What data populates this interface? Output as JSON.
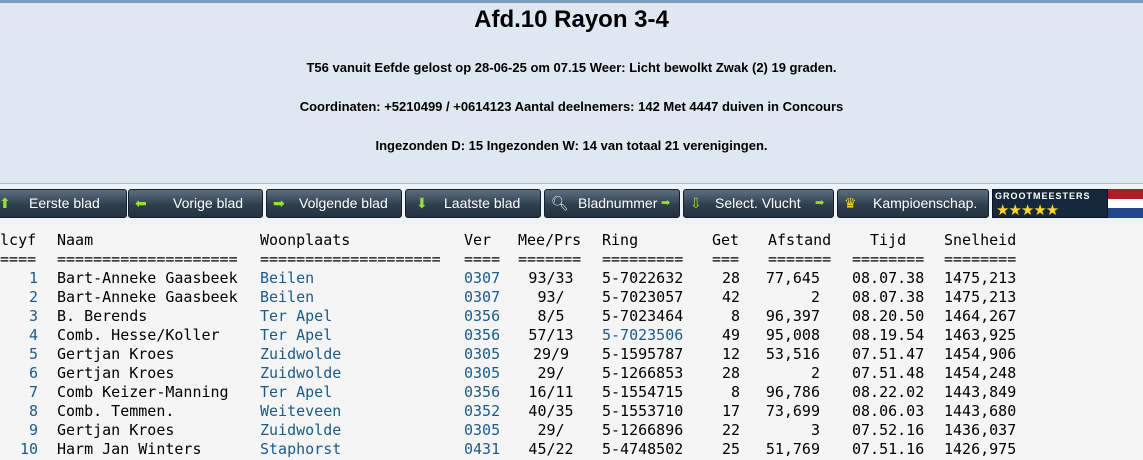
{
  "header": {
    "title": "Afd.10 Rayon 3-4",
    "line1": "T56 vanuit Eefde gelost op 28-06-25 om 07.15 Weer: Licht bewolkt Zwak (2) 19 graden.",
    "line2": "Coordinaten: +5210499 / +0614123 Aantal deelnemers: 142 Met 4447 duiven in Concours",
    "line3": "Ingezonden D: 15 Ingezonden W: 14 van totaal 21 verenigingen."
  },
  "nav": {
    "first": "Eerste blad",
    "prev": "Vorige blad",
    "next": "Volgende blad",
    "last": "Laatste blad",
    "page": "Bladnummer",
    "flight": "Select. Vlucht",
    "championship": "Kampioenschap.",
    "logo_text": "GROOTMEESTERS",
    "logo_stars": "★★★★★"
  },
  "colors": {
    "header_bg": "#dfe7f0",
    "button_bg": "#2f3f4e",
    "link": "#1a5b8a",
    "flag": [
      "#ae1c28",
      "#ffffff",
      "#21468b"
    ]
  },
  "table": {
    "headers": {
      "plcyf": "Plcyf",
      "naam": "Naam",
      "woonplaats": "Woonplaats",
      "ver": "Ver",
      "meeprs": "Mee/Prs",
      "ring": "Ring",
      "get": "Get",
      "afstand": "Afstand",
      "tijd": "Tijd",
      "snelheid": "Snelheid"
    },
    "underlines": {
      "plcyf": "=====",
      "naam": "====================",
      "woonplaats": "====================",
      "ver": "====",
      "meeprs": "=======",
      "ring": "=========",
      "get": "===",
      "afstand": "=======",
      "tijd": "========",
      "snelheid": "========"
    },
    "rows": [
      {
        "plcyf": "1",
        "naam": "Bart-Anneke Gaasbeek",
        "woonplaats": "Beilen",
        "ver": "0307",
        "meeprs": "93/33",
        "ring": "5-7022632",
        "get": "28",
        "afstand": "77,645",
        "tijd": "08.07.38",
        "snelheid": "1475,213"
      },
      {
        "plcyf": "2",
        "naam": "Bart-Anneke Gaasbeek",
        "woonplaats": "Beilen",
        "ver": "0307",
        "meeprs": "93/",
        "ring": "5-7023057",
        "get": "42",
        "afstand": "2",
        "tijd": "08.07.38",
        "snelheid": "1475,213"
      },
      {
        "plcyf": "3",
        "naam": "B. Berends",
        "woonplaats": "Ter Apel",
        "ver": "0356",
        "meeprs": "8/5",
        "ring": "5-7023464",
        "get": "8",
        "afstand": "96,397",
        "tijd": "08.20.50",
        "snelheid": "1464,267"
      },
      {
        "plcyf": "4",
        "naam": "Comb. Hesse/Koller",
        "woonplaats": "Ter Apel",
        "ver": "0356",
        "meeprs": "57/13",
        "ring": "5-7023506",
        "get": "49",
        "afstand": "95,008",
        "tijd": "08.19.54",
        "snelheid": "1463,925"
      },
      {
        "plcyf": "5",
        "naam": "Gertjan Kroes",
        "woonplaats": "Zuidwolde",
        "ver": "0305",
        "meeprs": "29/9",
        "ring": "5-1595787",
        "get": "12",
        "afstand": "53,516",
        "tijd": "07.51.47",
        "snelheid": "1454,906"
      },
      {
        "plcyf": "6",
        "naam": "Gertjan Kroes",
        "woonplaats": "Zuidwolde",
        "ver": "0305",
        "meeprs": "29/",
        "ring": "5-1266853",
        "get": "28",
        "afstand": "2",
        "tijd": "07.51.48",
        "snelheid": "1454,248"
      },
      {
        "plcyf": "7",
        "naam": "Comb Keizer-Manning",
        "woonplaats": "Ter Apel",
        "ver": "0356",
        "meeprs": "16/11",
        "ring": "5-1554715",
        "get": "8",
        "afstand": "96,786",
        "tijd": "08.22.02",
        "snelheid": "1443,849"
      },
      {
        "plcyf": "8",
        "naam": "Comb. Temmen.",
        "woonplaats": "Weiteveen",
        "ver": "0352",
        "meeprs": "40/35",
        "ring": "5-1553710",
        "get": "17",
        "afstand": "73,699",
        "tijd": "08.06.03",
        "snelheid": "1443,680"
      },
      {
        "plcyf": "9",
        "naam": "Gertjan Kroes",
        "woonplaats": "Zuidwolde",
        "ver": "0305",
        "meeprs": "29/",
        "ring": "5-1266896",
        "get": "22",
        "afstand": "3",
        "tijd": "07.52.16",
        "snelheid": "1436,037"
      },
      {
        "plcyf": "10",
        "naam": "Harm Jan Winters",
        "woonplaats": "Staphorst",
        "ver": "0431",
        "meeprs": "45/22",
        "ring": "5-4748502",
        "get": "25",
        "afstand": "51,769",
        "tijd": "07.51.16",
        "snelheid": "1426,975"
      }
    ]
  }
}
